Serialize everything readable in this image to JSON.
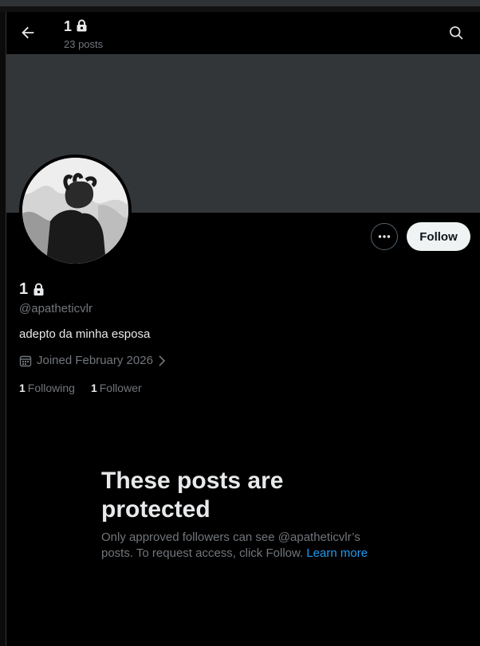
{
  "header": {
    "name": "1",
    "posts": "23 posts",
    "back_icon": "arrow-left-icon",
    "search_icon": "search-icon"
  },
  "profile": {
    "name": "1",
    "lock_icon": "lock-icon",
    "handle": "@apatheticvlr",
    "bio": "adepto da minha esposa",
    "joined": "Joined February 2026",
    "following_count": "1",
    "following_label": "Following",
    "followers_count": "1",
    "followers_label": "Follower"
  },
  "actions": {
    "follow_label": "Follow",
    "more_icon": "more-horizontal-icon"
  },
  "protected": {
    "title_line1": "These posts are",
    "title_line2": "protected",
    "desc": "Only approved followers can see @apatheticvlr’s posts. To request access, click Follow.",
    "learn_more": "Learn more"
  },
  "colors": {
    "background": "#000000",
    "banner": "#333639",
    "text_primary": "#e7e9ea",
    "text_secondary": "#71767b",
    "link": "#1d9bf0",
    "follow_button": "#eff3f4"
  }
}
